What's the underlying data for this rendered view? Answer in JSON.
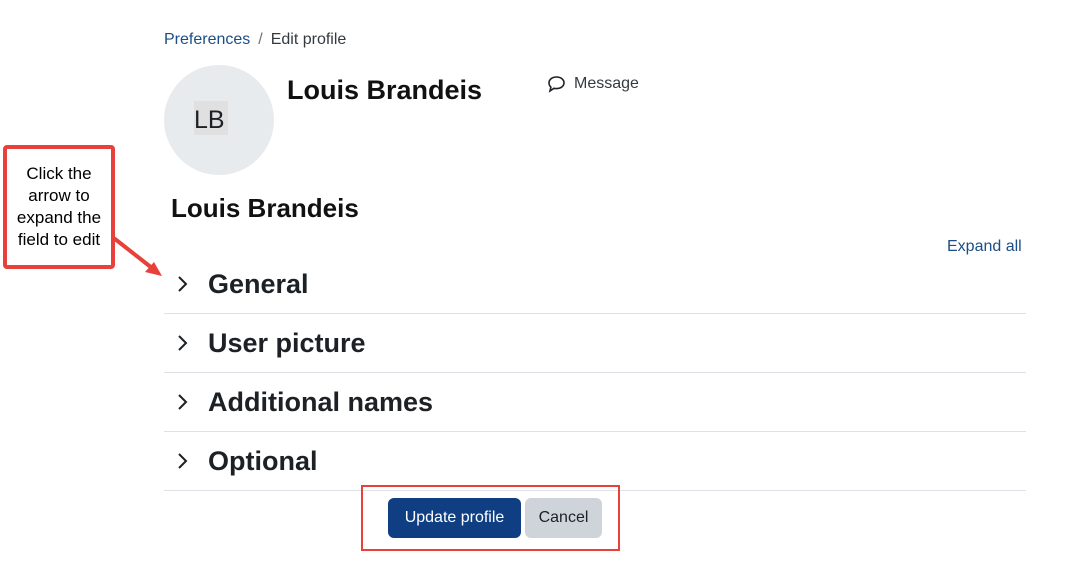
{
  "breadcrumb": {
    "parent": "Preferences",
    "separator": "/",
    "current": "Edit profile"
  },
  "user": {
    "initials": "LB",
    "name": "Louis Brandeis"
  },
  "message": {
    "label": "Message",
    "icon": "speech-bubble-icon"
  },
  "heading": "Louis Brandeis",
  "expand_all": "Expand all",
  "sections": [
    {
      "title": "General",
      "icon": "chevron-right-icon"
    },
    {
      "title": "User picture",
      "icon": "chevron-right-icon"
    },
    {
      "title": "Additional names",
      "icon": "chevron-right-icon"
    },
    {
      "title": "Optional",
      "icon": "chevron-right-icon"
    }
  ],
  "buttons": {
    "update": "Update profile",
    "cancel": "Cancel"
  },
  "annotation": {
    "text": "Click the arrow to expand the field to edit"
  },
  "colors": {
    "link": "#1b4e86",
    "primary": "#0f3f82",
    "secondary": "#ced4da",
    "annotation": "#e8403a"
  }
}
